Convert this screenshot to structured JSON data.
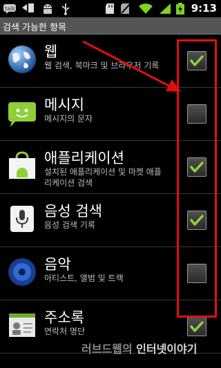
{
  "status_bar": {
    "time": "9:13",
    "left_icons": [
      "talk-icon",
      "usb-transfer-icon",
      "android-debug-icon",
      "usb-icon"
    ],
    "right_icons": [
      "sd-card-icon",
      "no-sim-icon",
      "wifi-icon",
      "signal-icon",
      "battery-icon"
    ]
  },
  "header": {
    "title": "검색 가능한 항목"
  },
  "items": [
    {
      "title": "웹",
      "subtitle": "웹 검색, 북마크 및 브라우저 기록",
      "checked": true,
      "icon": "globe-icon"
    },
    {
      "title": "메시지",
      "subtitle": "메시지의 문자",
      "checked": false,
      "icon": "message-icon"
    },
    {
      "title": "애플리케이션",
      "subtitle": "설치된 애플리케이션 및 마켓 애플리케이션 검색",
      "checked": true,
      "icon": "market-icon"
    },
    {
      "title": "음성 검색",
      "subtitle": "음성 검색 기록",
      "checked": true,
      "icon": "microphone-icon"
    },
    {
      "title": "음악",
      "subtitle": "아티스트, 앨범 및 트랙",
      "checked": false,
      "icon": "speaker-icon"
    },
    {
      "title": "주소록",
      "subtitle": "연락처 명단",
      "checked": true,
      "icon": "contacts-icon"
    }
  ],
  "watermark": {
    "part1": "러브드웹의 ",
    "part2": "인터넷이야기"
  },
  "colors": {
    "accent_check": "#8fd33a",
    "annotation_red": "#e01010",
    "header_bg": "#555555"
  }
}
